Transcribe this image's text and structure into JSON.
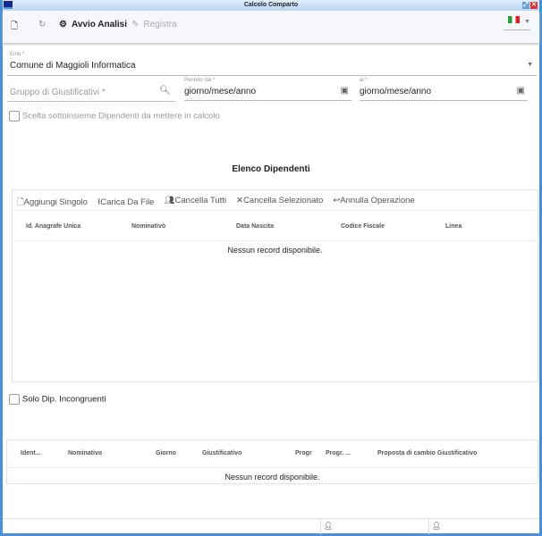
{
  "window": {
    "title": "Calcolo Comparto"
  },
  "toolbar": {
    "new_icon": "document-icon",
    "refresh_icon": "refresh-icon",
    "avvio": "Avvio Analisi",
    "registra": "Registra",
    "language": "it"
  },
  "form": {
    "ente_label": "Ente *",
    "ente_value": "Comune di Maggioli Informatica",
    "gruppo_placeholder": "Gruppo di Giustificativi *",
    "periodo_dal_label": "Periodo dal *",
    "periodo_dal_value": "giorno/mese/anno",
    "al_label": "al *",
    "al_value": "giorno/mese/anno",
    "scelta_label": "Scelta sottoinsieme Dipendenti da mettere in calcolo"
  },
  "dipendenti": {
    "title": "Elenco Dipendenti",
    "actions": [
      "Aggiungi Singolo",
      "Carica Da File",
      "Cancella Tutti",
      "Cancella Selezionato",
      "Annulla Operazione"
    ],
    "columns": [
      "Id. Anagrafe Unica",
      "Nominativo",
      "Data Nascita",
      "Codice Fiscale",
      "Linea"
    ],
    "empty": "Nessun record disponibile."
  },
  "incongruenti": {
    "checkbox_label": "Solo Dip. Incongruenti",
    "columns": [
      "Ident...",
      "Nominativo",
      "Giorno",
      "Giustificativo",
      "Progr",
      "Progr. ...",
      "Proposta di cambio Giustificativo"
    ],
    "empty": "Nessun record disponibile."
  },
  "colors": {
    "frame": "#4a8fd8",
    "toolbar_bg": "#f6f7fb"
  }
}
